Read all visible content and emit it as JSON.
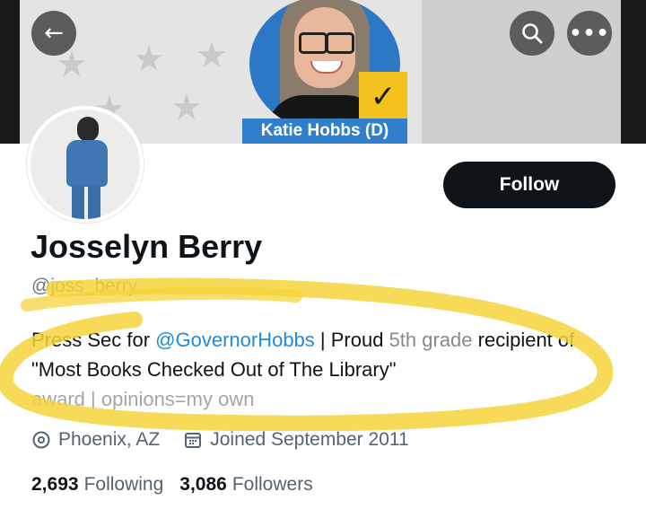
{
  "banner": {
    "candidate_tag": "Katie Hobbs (D)",
    "check_glyph": "✓"
  },
  "icons": {
    "back": "arrow-left-icon",
    "search": "search-icon",
    "more": "more-horizontal-icon",
    "location": "location-pin-icon",
    "calendar": "calendar-icon"
  },
  "top_buttons": {
    "back_glyph": "←",
    "more_glyph": "•••"
  },
  "profile": {
    "follow_label": "Follow",
    "display_name": "Josselyn Berry",
    "handle": "@joss_berry",
    "bio_prefix": "Press Sec for ",
    "bio_mention": "@GovernorHobbs",
    "bio_mid": " | Proud ",
    "bio_faded_1": "5th grade",
    "bio_line2": " recipient of \"Most Books Checked Out of The Li",
    "bio_line2_end": "brary\"",
    "bio_faded_2": "award | opinions=my own",
    "location": "Phoenix, AZ",
    "joined": "Joined September 2011"
  },
  "stats": {
    "following_count": "2,693",
    "following_label": "Following",
    "followers_count": "3,086",
    "followers_label": "Followers"
  },
  "colors": {
    "accent_link": "#1d8ce0",
    "follow_button_bg": "#0f1419",
    "highlight_marker": "#f5d33b",
    "banner_blue": "#2f7fcc",
    "check_yellow": "#f4c21d"
  }
}
